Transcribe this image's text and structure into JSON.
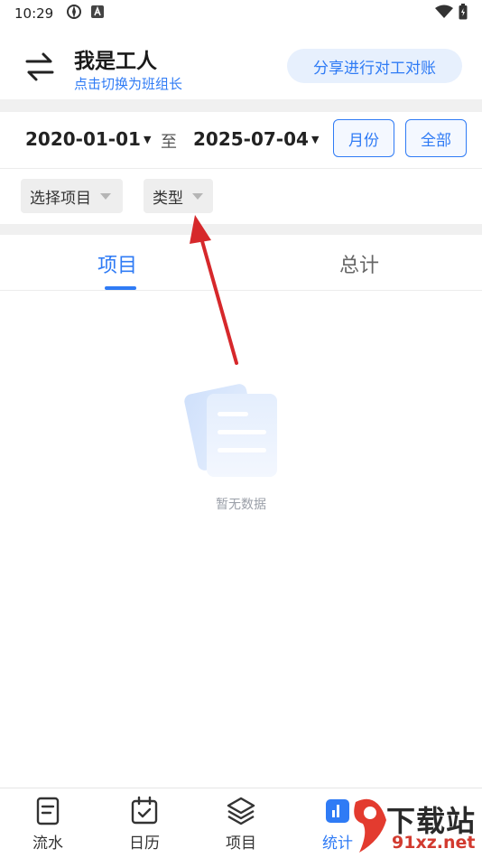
{
  "status_bar": {
    "time": "10:29"
  },
  "header": {
    "title": "我是工人",
    "subtitle": "点击切换为班组长",
    "share_label": "分享进行对工对账"
  },
  "date_range": {
    "start": "2020-01-01",
    "separator": "至",
    "end": "2025-07-04",
    "month_label": "月份",
    "all_label": "全部"
  },
  "filters": {
    "project": "选择项目",
    "type": "类型"
  },
  "tabs": [
    {
      "label": "项目",
      "active": true
    },
    {
      "label": "总计",
      "active": false
    }
  ],
  "empty_state": {
    "text": "暂无数据"
  },
  "bottom_nav": [
    {
      "label": "流水",
      "icon": "document-icon"
    },
    {
      "label": "日历",
      "icon": "calendar-icon"
    },
    {
      "label": "项目",
      "icon": "layers-icon"
    },
    {
      "label": "统计",
      "icon": "chart-icon",
      "active": true
    }
  ],
  "watermark": {
    "brand": "下载站",
    "domain": "91xz.net"
  },
  "colors": {
    "accent": "#2f7bf5",
    "annotation": "#d6282b"
  }
}
